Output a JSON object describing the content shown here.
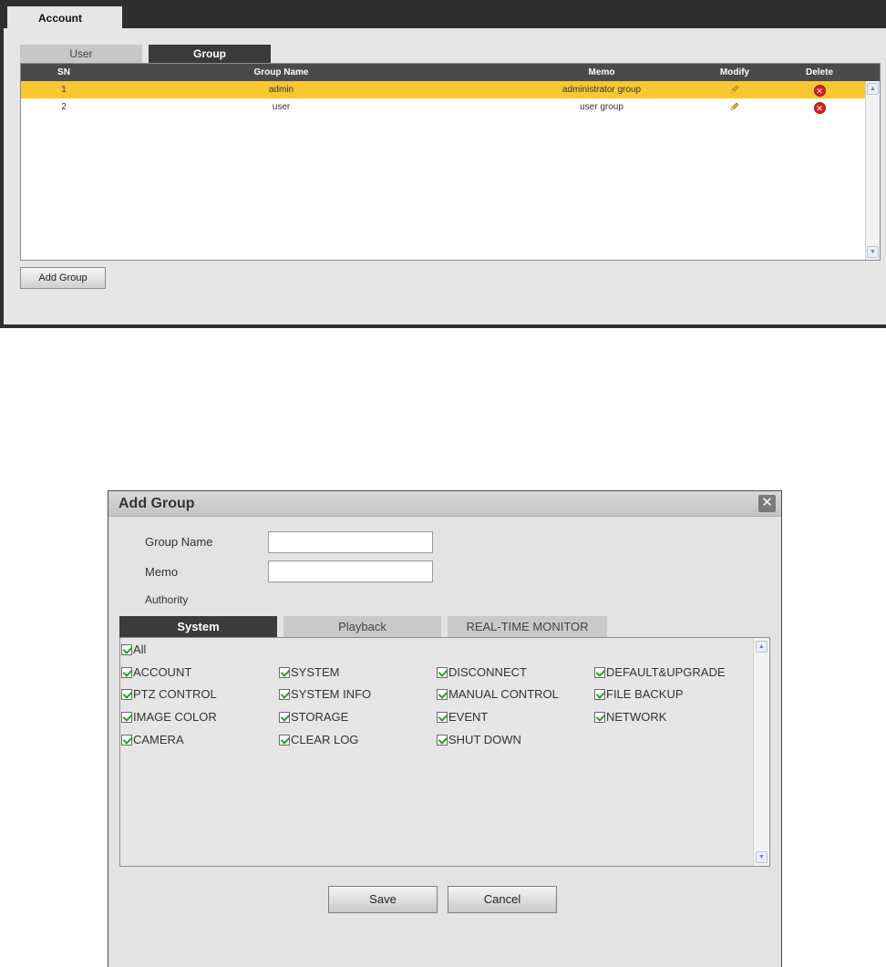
{
  "account": {
    "tab_label": "Account",
    "subtabs": [
      {
        "label": "User",
        "active": false
      },
      {
        "label": "Group",
        "active": true
      }
    ],
    "table": {
      "headers": {
        "sn": "SN",
        "group_name": "Group Name",
        "memo": "Memo",
        "modify": "Modify",
        "delete": "Delete"
      },
      "rows": [
        {
          "sn": "1",
          "group_name": "admin",
          "memo": "administrator group",
          "selected": true
        },
        {
          "sn": "2",
          "group_name": "user",
          "memo": "user group",
          "selected": false
        }
      ]
    },
    "add_group_label": "Add Group"
  },
  "dialog": {
    "title": "Add Group",
    "close_icon": "close-icon",
    "group_name_label": "Group Name",
    "group_name_value": "",
    "memo_label": "Memo",
    "memo_value": "",
    "authority_label": "Authority",
    "tabs": [
      {
        "label": "System",
        "active": true
      },
      {
        "label": "Playback",
        "active": false
      },
      {
        "label": "REAL-TIME MONITOR",
        "active": false
      }
    ],
    "all_label": "All",
    "checkboxes": [
      [
        "ACCOUNT",
        "SYSTEM",
        "DISCONNECT",
        "DEFAULT&UPGRADE"
      ],
      [
        "PTZ CONTROL",
        "SYSTEM INFO",
        "MANUAL CONTROL",
        "FILE BACKUP"
      ],
      [
        "IMAGE COLOR",
        "STORAGE",
        "EVENT",
        "NETWORK"
      ],
      [
        "CAMERA",
        "CLEAR LOG",
        "SHUT DOWN"
      ]
    ],
    "save_label": "Save",
    "cancel_label": "Cancel"
  },
  "colors": {
    "selected_row": "#f9c731",
    "dark_header": "#4a4a4a",
    "check_green": "#2a9d2a",
    "delete_red": "#d8231f"
  }
}
